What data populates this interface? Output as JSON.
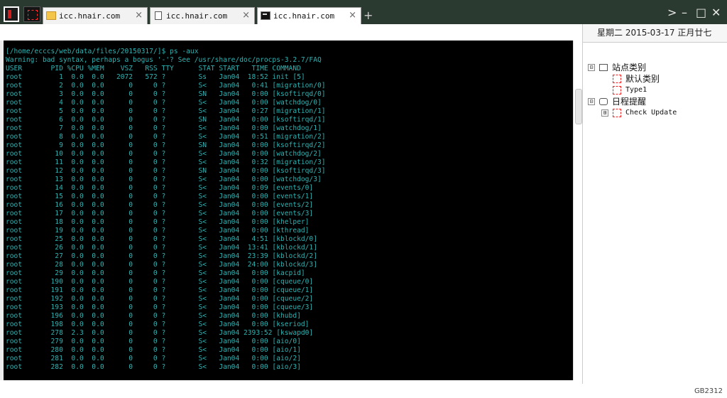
{
  "tabs": [
    {
      "label": "icc.hnair.com",
      "close": "×",
      "icon": "folder-icon"
    },
    {
      "label": "icc.hnair.com",
      "close": "×",
      "icon": "page-icon"
    },
    {
      "label": "icc.hnair.com",
      "close": "×",
      "icon": "terminal-icon"
    }
  ],
  "toolbar": {
    "new_tab": "+",
    "chevron": ">",
    "minimize": "–",
    "maximize": "□",
    "close": "✕"
  },
  "sidebar": {
    "date": "星期二 2015-03-17 正月廿七",
    "tree": [
      {
        "label": "站点类别",
        "expander": "⊟"
      },
      {
        "label": "默认类别"
      },
      {
        "label": "Type1"
      },
      {
        "label": "日程提醒",
        "expander": "⊟"
      },
      {
        "label": "Check Update",
        "expander": "⊞"
      }
    ]
  },
  "status": {
    "encoding": "GB2312"
  },
  "terminal": {
    "lines": [
      "[/home/ecccs/web/data/files/20150317/]$ ps -aux",
      "Warning: bad syntax, perhaps a bogus '-'? See /usr/share/doc/procps-3.2.7/FAQ",
      "USER       PID %CPU %MEM    VSZ   RSS TTY      STAT START   TIME COMMAND",
      "root         1  0.0  0.0   2072   572 ?        Ss   Jan04  18:52 init [5]",
      "root         2  0.0  0.0      0     0 ?        S<   Jan04   0:41 [migration/0]",
      "root         3  0.0  0.0      0     0 ?        SN   Jan04   0:00 [ksoftirqd/0]",
      "root         4  0.0  0.0      0     0 ?        S<   Jan04   0:00 [watchdog/0]",
      "root         5  0.0  0.0      0     0 ?        S<   Jan04   0:27 [migration/1]",
      "root         6  0.0  0.0      0     0 ?        SN   Jan04   0:00 [ksoftirqd/1]",
      "root         7  0.0  0.0      0     0 ?        S<   Jan04   0:00 [watchdog/1]",
      "root         8  0.0  0.0      0     0 ?        S<   Jan04   0:51 [migration/2]",
      "root         9  0.0  0.0      0     0 ?        SN   Jan04   0:00 [ksoftirqd/2]",
      "root        10  0.0  0.0      0     0 ?        S<   Jan04   0:00 [watchdog/2]",
      "root        11  0.0  0.0      0     0 ?        S<   Jan04   0:32 [migration/3]",
      "root        12  0.0  0.0      0     0 ?        SN   Jan04   0:00 [ksoftirqd/3]",
      "root        13  0.0  0.0      0     0 ?        S<   Jan04   0:00 [watchdog/3]",
      "root        14  0.0  0.0      0     0 ?        S<   Jan04   0:09 [events/0]",
      "root        15  0.0  0.0      0     0 ?        S<   Jan04   0:00 [events/1]",
      "root        16  0.0  0.0      0     0 ?        S<   Jan04   0:00 [events/2]",
      "root        17  0.0  0.0      0     0 ?        S<   Jan04   0:00 [events/3]",
      "root        18  0.0  0.0      0     0 ?        S<   Jan04   0:00 [khelper]",
      "root        19  0.0  0.0      0     0 ?        S<   Jan04   0:00 [kthread]",
      "root        25  0.0  0.0      0     0 ?        S<   Jan04   4:51 [kblockd/0]",
      "root        26  0.0  0.0      0     0 ?        S<   Jan04  13:41 [kblockd/1]",
      "root        27  0.0  0.0      0     0 ?        S<   Jan04  23:39 [kblockd/2]",
      "root        28  0.0  0.0      0     0 ?        S<   Jan04  24:00 [kblockd/3]",
      "root        29  0.0  0.0      0     0 ?        S<   Jan04   0:00 [kacpid]",
      "root       190  0.0  0.0      0     0 ?        S<   Jan04   0:00 [cqueue/0]",
      "root       191  0.0  0.0      0     0 ?        S<   Jan04   0:00 [cqueue/1]",
      "root       192  0.0  0.0      0     0 ?        S<   Jan04   0:00 [cqueue/2]",
      "root       193  0.0  0.0      0     0 ?        S<   Jan04   0:00 [cqueue/3]",
      "root       196  0.0  0.0      0     0 ?        S<   Jan04   0:00 [khubd]",
      "root       198  0.0  0.0      0     0 ?        S<   Jan04   0:00 [kseriod]",
      "root       278  2.3  0.0      0     0 ?        S<   Jan04 2393:52 [kswapd0]",
      "root       279  0.0  0.0      0     0 ?        S<   Jan04   0:00 [aio/0]",
      "root       280  0.0  0.0      0     0 ?        S<   Jan04   0:00 [aio/1]",
      "root       281  0.0  0.0      0     0 ?        S<   Jan04   0:00 [aio/2]",
      "root       282  0.0  0.0      0     0 ?        S<   Jan04   0:00 [aio/3]"
    ]
  }
}
